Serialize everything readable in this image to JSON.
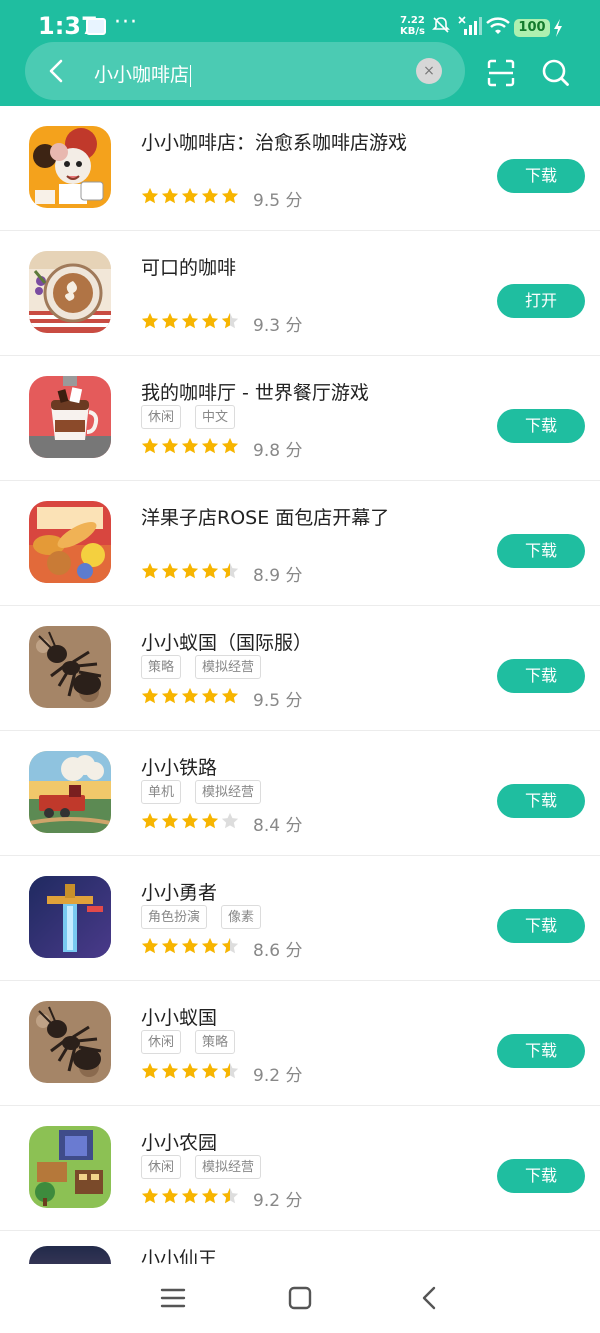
{
  "status_bar": {
    "time": "1:37",
    "dots": "···",
    "speed_value": "7.22",
    "speed_unit": "KB/s",
    "battery": "100"
  },
  "search": {
    "query": "小小咖啡店",
    "clear_symbol": "×"
  },
  "colors": {
    "accent": "#1fbea0",
    "star": "#f7b500",
    "star_empty": "#dddddd"
  },
  "apps": [
    {
      "name": "小小咖啡店：治愈系咖啡店游戏",
      "tags": [],
      "rating": 5,
      "score": "9.5 分",
      "button": "下载",
      "icon": "cartoon-mouse-barista"
    },
    {
      "name": "可口的咖啡",
      "tags": [],
      "rating": 4.5,
      "score": "9.3 分",
      "button": "打开",
      "icon": "latte-art-cup"
    },
    {
      "name": "我的咖啡厅 - 世界餐厅游戏",
      "tags": [
        "休闲",
        "中文"
      ],
      "rating": 5,
      "score": "9.8 分",
      "button": "下载",
      "icon": "hot-chocolate-cup"
    },
    {
      "name": "洋果子店ROSE 面包店开幕了",
      "tags": [],
      "rating": 4.5,
      "score": "8.9 分",
      "button": "下载",
      "icon": "bakery-pastries"
    },
    {
      "name": "小小蚁国（国际服）",
      "tags": [
        "策略",
        "模拟经营"
      ],
      "rating": 5,
      "score": "9.5 分",
      "button": "下载",
      "icon": "ant"
    },
    {
      "name": "小小铁路",
      "tags": [
        "单机",
        "模拟经营"
      ],
      "rating": 4,
      "score": "8.4 分",
      "button": "下载",
      "icon": "steam-train"
    },
    {
      "name": "小小勇者",
      "tags": [
        "角色扮演",
        "像素"
      ],
      "rating": 4.5,
      "score": "8.6 分",
      "button": "下载",
      "icon": "pixel-sword"
    },
    {
      "name": "小小蚁国",
      "tags": [
        "休闲",
        "策略"
      ],
      "rating": 4.5,
      "score": "9.2 分",
      "button": "下载",
      "icon": "ant"
    },
    {
      "name": "小小农园",
      "tags": [
        "休闲",
        "模拟经营"
      ],
      "rating": 4.5,
      "score": "9.2 分",
      "button": "下载",
      "icon": "pixel-farm"
    }
  ],
  "partial_app": {
    "name": "小小仙王"
  }
}
